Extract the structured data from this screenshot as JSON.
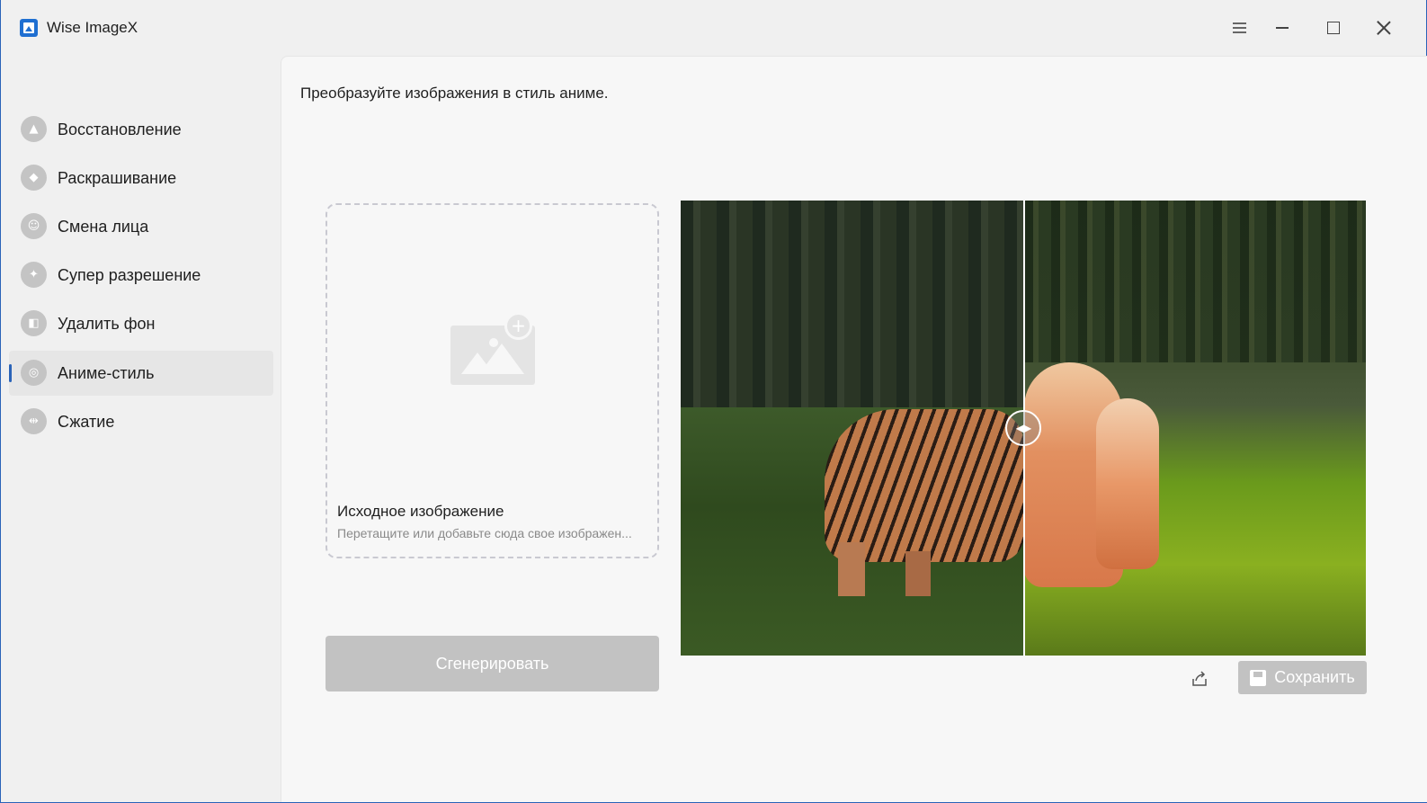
{
  "app": {
    "title": "Wise ImageX",
    "window_controls": [
      "menu-icon",
      "minimize-icon",
      "maximize-icon",
      "close-icon"
    ]
  },
  "sidebar": {
    "items": [
      {
        "label": "Восстановление",
        "icon": "restore-icon",
        "active": false
      },
      {
        "label": "Раскрашивание",
        "icon": "colorize-icon",
        "active": false
      },
      {
        "label": "Смена лица",
        "icon": "face-swap-icon",
        "active": false
      },
      {
        "label": "Супер разрешение",
        "icon": "super-resolution-icon",
        "active": false
      },
      {
        "label": "Удалить фон",
        "icon": "remove-background-icon",
        "active": false
      },
      {
        "label": "Аниме-стиль",
        "icon": "anime-style-icon",
        "active": true
      },
      {
        "label": "Сжатие",
        "icon": "compress-icon",
        "active": false
      }
    ]
  },
  "main": {
    "headline": "Преобразуйте изображения в стиль аниме.",
    "dropzone": {
      "title": "Исходное изображение",
      "subtitle": "Перетащите или добавьте сюда свое изображен..."
    },
    "generate_label": "Сгенерировать",
    "save_label": "Сохранить"
  },
  "colors": {
    "accent": "#2a63b8",
    "disabled_button": "#c2c2c2"
  }
}
